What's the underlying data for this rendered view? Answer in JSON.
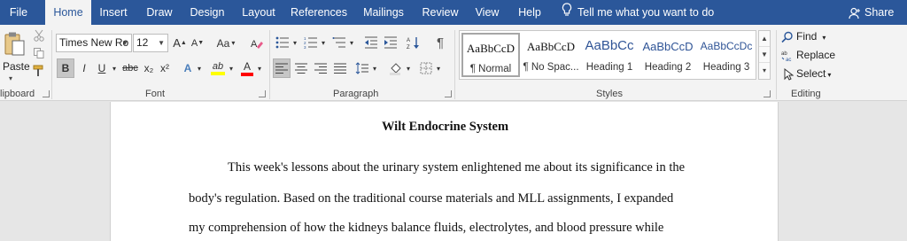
{
  "tabs": [
    "File",
    "Home",
    "Insert",
    "Draw",
    "Design",
    "Layout",
    "References",
    "Mailings",
    "Review",
    "View",
    "Help"
  ],
  "active_tab": "Home",
  "tell_me": "Tell me what you want to do",
  "share": "Share",
  "clipboard": {
    "paste": "Paste",
    "group_label": "lipboard"
  },
  "font": {
    "name": "Times New Ro",
    "size": "12",
    "case_label": "Aa",
    "group_label": "Font",
    "bold": "B",
    "italic": "I",
    "underline": "U",
    "strike": "abc",
    "subscript": "x₂",
    "superscript": "x²",
    "grow": "A",
    "shrink": "A",
    "text_effects": "A",
    "font_color": "A",
    "highlight": "ab",
    "highlight_color": "#ffff00",
    "font_color_value": "#ff0000"
  },
  "paragraph": {
    "group_label": "Paragraph",
    "pilcrow": "¶"
  },
  "styles": {
    "group_label": "Styles",
    "items": [
      {
        "preview": "AaBbCcD",
        "name": "¶ Normal"
      },
      {
        "preview": "AaBbCcD",
        "name": "¶ No Spac..."
      },
      {
        "preview": "AaBbCc",
        "name": "Heading 1"
      },
      {
        "preview": "AaBbCcD",
        "name": "Heading 2"
      },
      {
        "preview": "AaBbCcDc",
        "name": "Heading 3"
      }
    ],
    "heading_color": "#2f5496"
  },
  "editing": {
    "find": "Find",
    "replace": "Replace",
    "select": "Select",
    "group_label": "Editing"
  },
  "document": {
    "title": "Wilt Endocrine System",
    "lines": [
      "This week's lessons about the urinary system enlightened me about its significance in the",
      "body's regulation. Based on the traditional course materials and MLL assignments, I expanded",
      "my comprehension of how the kidneys balance fluids, electrolytes, and blood pressure while"
    ]
  },
  "colors": {
    "accent": "#2b579a",
    "ribbon": "#f3f3f3"
  }
}
